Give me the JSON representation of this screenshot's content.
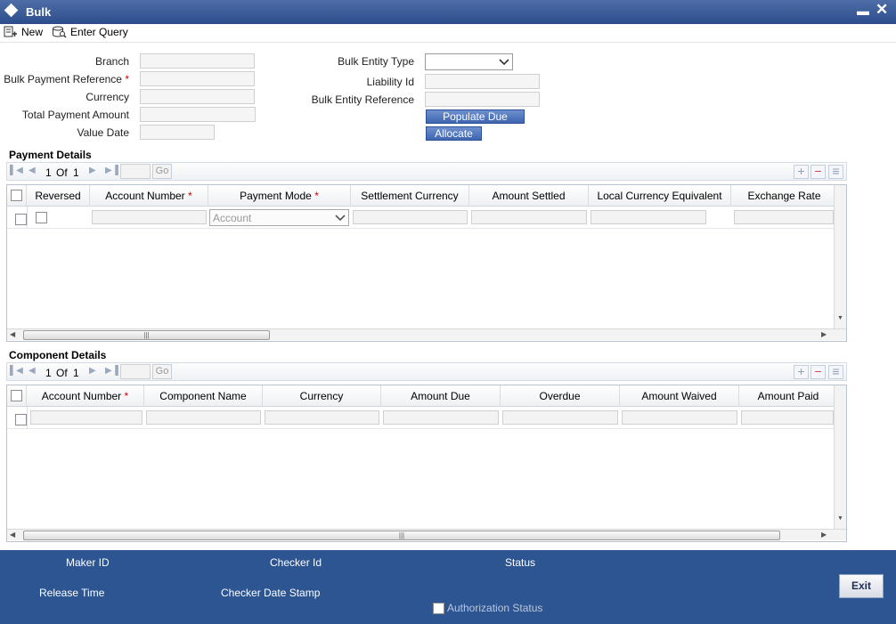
{
  "window": {
    "title": "Bulk"
  },
  "toolbar": {
    "new_label": "New",
    "enter_query_label": "Enter Query"
  },
  "form": {
    "branch_label": "Branch",
    "bulk_payment_reference_label": "Bulk Payment Reference",
    "currency_label": "Currency",
    "total_payment_amount_label": "Total Payment Amount",
    "value_date_label": "Value Date",
    "bulk_entity_type_label": "Bulk Entity Type",
    "liability_id_label": "Liability Id",
    "bulk_entity_reference_label": "Bulk Entity Reference",
    "populate_due_label": "Populate Due",
    "allocate_label": "Allocate",
    "required_mark": "*"
  },
  "payment_details": {
    "title": "Payment Details",
    "pager": {
      "page": "1",
      "of_label": "Of",
      "total": "1",
      "go_label": "Go"
    },
    "columns": [
      "Reversed",
      "Account Number",
      "Payment Mode",
      "Settlement Currency",
      "Amount Settled",
      "Local Currency Equivalent",
      "Exchange Rate"
    ],
    "payment_mode_value": "Account"
  },
  "component_details": {
    "title": "Component Details",
    "pager": {
      "page": "1",
      "of_label": "Of",
      "total": "1",
      "go_label": "Go"
    },
    "columns": [
      "Account Number",
      "Component Name",
      "Currency",
      "Amount Due",
      "Overdue",
      "Amount Waived",
      "Amount Paid"
    ]
  },
  "footer": {
    "maker_id_label": "Maker ID",
    "checker_id_label": "Checker Id",
    "status_label": "Status",
    "release_time_label": "Release Time",
    "checker_date_stamp_label": "Checker Date Stamp",
    "authorization_status_label": "Authorization Status",
    "exit_label": "Exit"
  }
}
